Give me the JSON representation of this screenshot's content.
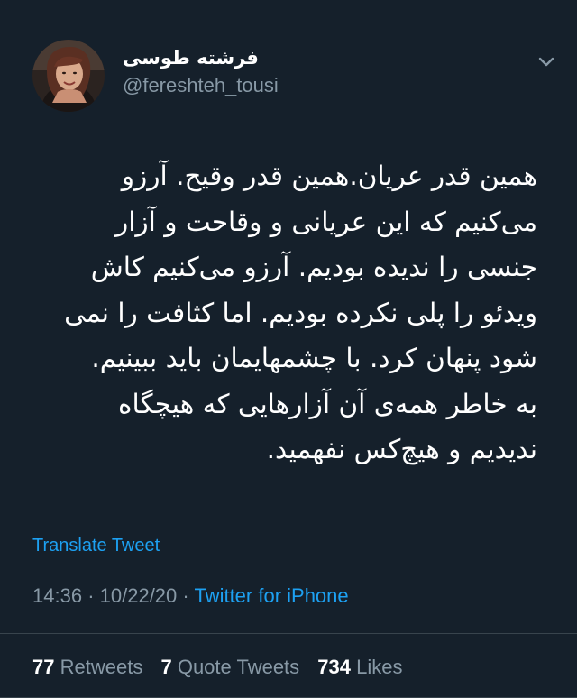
{
  "author": {
    "display_name": "فرشته طوسی",
    "handle": "@fereshteh_tousi"
  },
  "tweet": {
    "text": "همین قدر عریان.همین قدر وقیح. آرزو\nمی‌کنیم که این عریانی و وقاحت و آزار\nجنسی را ندیده بودیم. آرزو می‌کنیم کاش\nویدئو را پلی نکرده بودیم. اما کثافت را نمی\nشود پنهان کرد. با چشمهایمان باید ببینیم.\nبه خاطر همه‌ی آن آزارهایی که هیچگاه\nندیدیم و هیچ‌کس نفهمید.",
    "translate_label": "Translate Tweet",
    "time": "14:36",
    "date": "10/22/20",
    "separator": "·",
    "source": "Twitter for iPhone"
  },
  "stats": {
    "retweets_count": "77",
    "retweets_label": "Retweets",
    "quotes_count": "7",
    "quotes_label": "Quote Tweets",
    "likes_count": "734",
    "likes_label": "Likes"
  },
  "icons": {
    "menu": "chevron-down-icon"
  },
  "colors": {
    "background": "#15202b",
    "text": "#ffffff",
    "secondary": "#8899a6",
    "accent": "#1da1f2",
    "divider": "#38444d"
  }
}
